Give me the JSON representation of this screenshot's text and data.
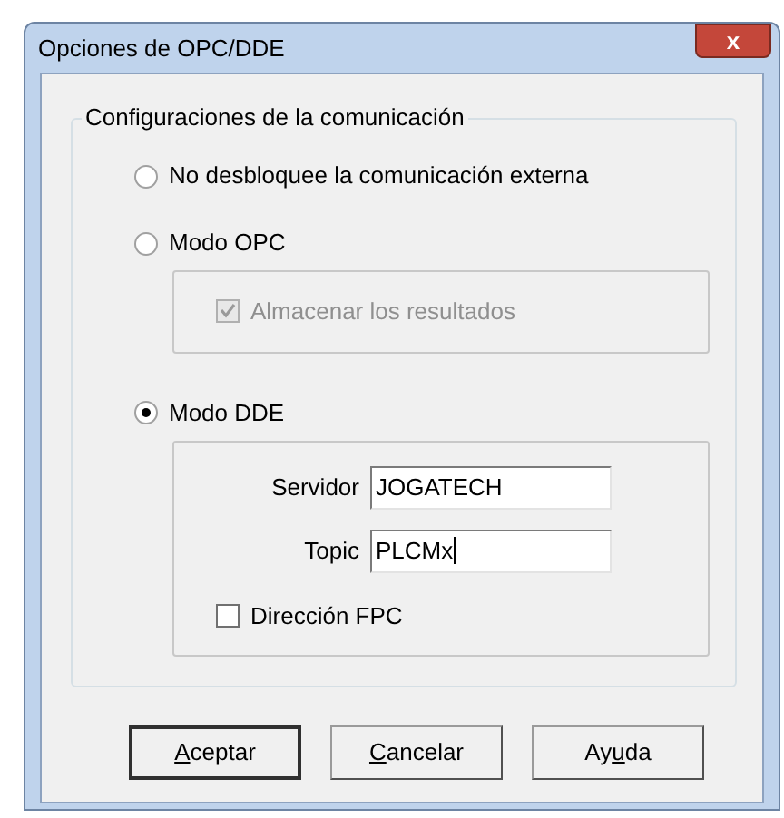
{
  "window": {
    "title": "Opciones de OPC/DDE",
    "close": "x"
  },
  "group": {
    "legend": "Configuraciones de la comunicación"
  },
  "options": [
    {
      "label": "No desbloquee la comunicación externa",
      "selected": false
    },
    {
      "label": "Modo OPC",
      "selected": false,
      "panel": {
        "checkboxes": [
          {
            "label": "Almacenar los resultados",
            "checked": true,
            "disabled": true
          }
        ]
      }
    },
    {
      "label": "Modo DDE",
      "selected": true,
      "panel": {
        "fields": [
          {
            "label": "Servidor",
            "value": "JOGATECH"
          },
          {
            "label": "Topic",
            "value": "PLCMx",
            "focused": true
          }
        ],
        "checkboxes": [
          {
            "label": "Dirección FPC",
            "checked": false,
            "disabled": false
          }
        ]
      }
    }
  ],
  "buttons": [
    {
      "access_key": "A",
      "label_after": "ceptar",
      "default": true
    },
    {
      "access_key": "C",
      "label_after": "ancelar",
      "default": false
    },
    {
      "label_before": "Ay",
      "access_key": "u",
      "label_after": "da",
      "default": false
    }
  ]
}
